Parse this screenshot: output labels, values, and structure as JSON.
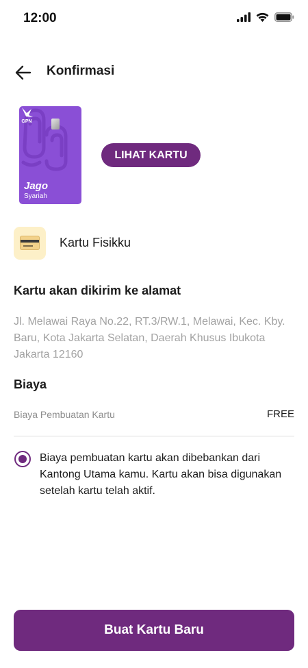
{
  "status_bar": {
    "time": "12:00",
    "icons": [
      "signal-icon",
      "wifi-icon",
      "battery-icon"
    ]
  },
  "header": {
    "title": "Konfirmasi",
    "back_icon": "back-arrow-icon"
  },
  "card": {
    "brand": "Jago",
    "sub": "Syariah",
    "network_logo": "GPN",
    "color": "#8a4fd6"
  },
  "lihat_kartu_label": "LIHAT KARTU",
  "product": {
    "icon": "card-icon",
    "label": "Kartu Fisikku"
  },
  "address_section": {
    "title": "Kartu akan dikirim ke alamat",
    "address": "Jl. Melawai Raya No.22, RT.3/RW.1, Melawai, Kec. Kby. Baru, Kota Jakarta Selatan, Daerah Khusus Ibukota Jakarta 12160"
  },
  "fee_section": {
    "title": "Biaya",
    "fee_label": "Biaya Pembuatan Kartu",
    "fee_value": "FREE"
  },
  "consent": {
    "checked": true,
    "text": "Biaya pembuatan kartu akan dibebankan dari Kantong Utama kamu. Kartu akan bisa digunakan setelah kartu telah aktif."
  },
  "primary_button_label": "Buat Kartu Baru",
  "colors": {
    "accent": "#6f2a7e",
    "card_purple": "#8a4fd6",
    "muted_text": "#a2a2a2"
  }
}
